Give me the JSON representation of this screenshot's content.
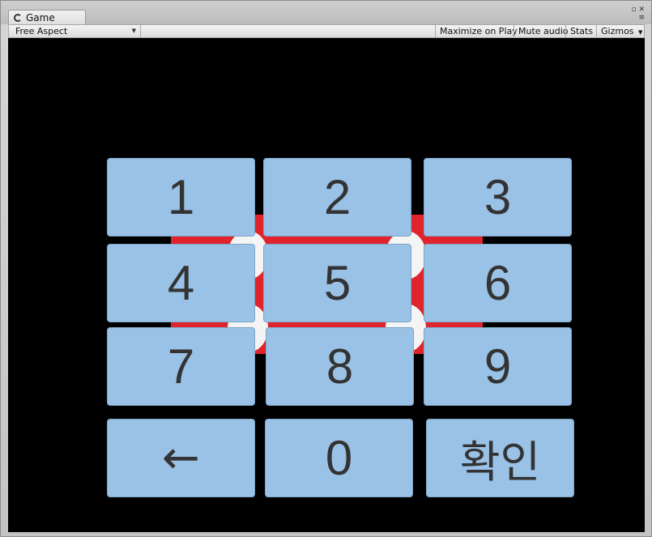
{
  "window": {
    "tab_title": "Game",
    "tab_icon": "unity-logo-icon"
  },
  "toolbar": {
    "aspect_label": "Free Aspect",
    "maximize_label": "Maximize on Play",
    "mute_label": "Mute audio",
    "stats_label": "Stats",
    "gizmos_label": "Gizmos"
  },
  "keypad": {
    "keys": [
      "1",
      "2",
      "3",
      "4",
      "5",
      "6",
      "7",
      "8",
      "9",
      "←",
      "0",
      "확인"
    ]
  },
  "colors": {
    "key_fill": "#99c2e6",
    "key_text": "#333333",
    "background_red": "#e0242e",
    "game_bg": "#000000"
  }
}
